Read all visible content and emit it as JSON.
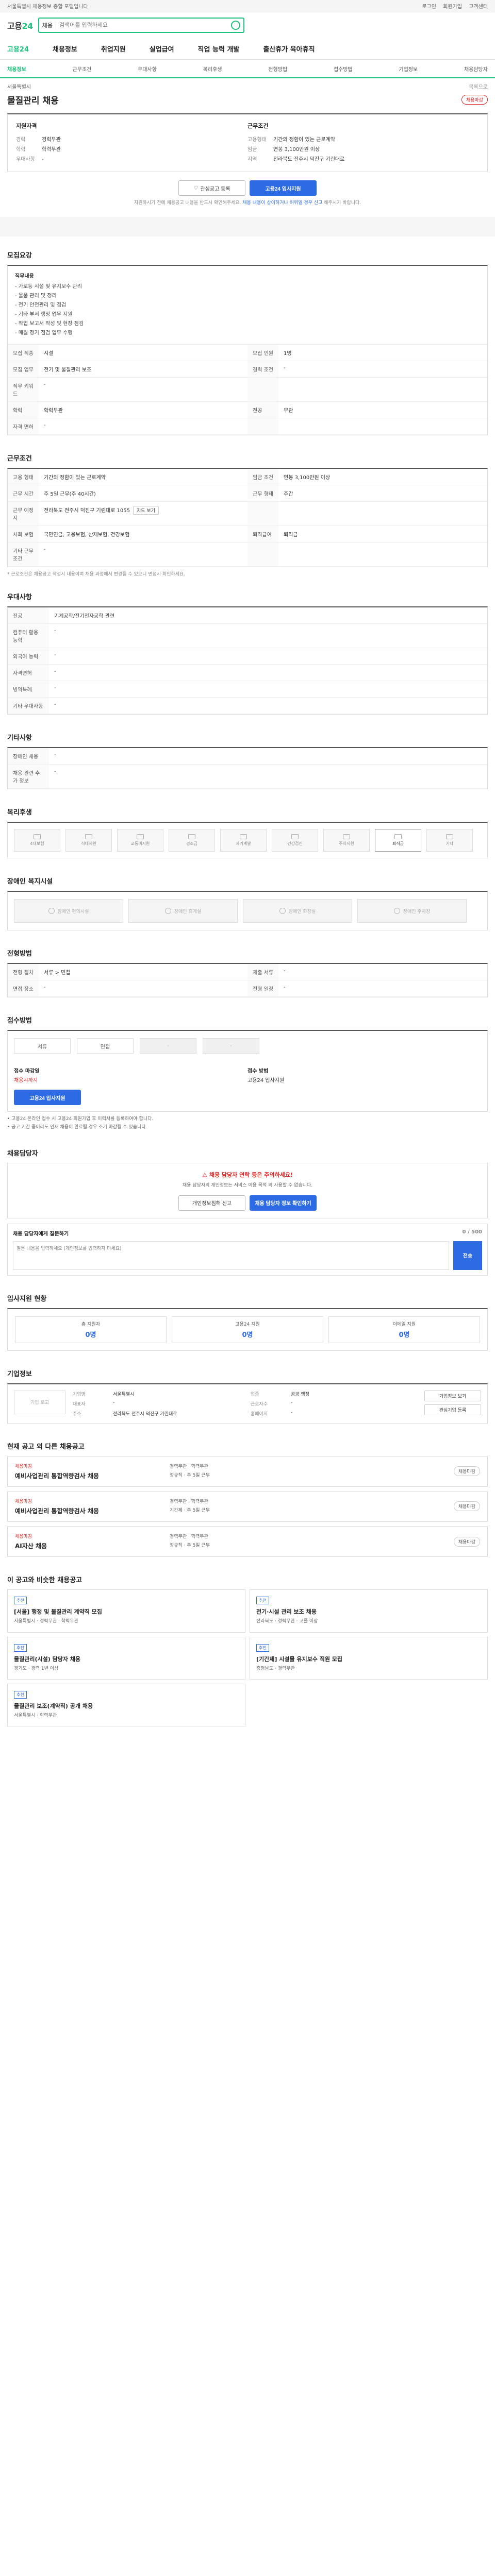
{
  "topbar": {
    "notice": "서울특별시 채용정보 종합 포털입니다",
    "links": [
      "로그인",
      "회원가입",
      "고객센터"
    ]
  },
  "header": {
    "logo_a": "고용",
    "logo_b": "24",
    "search_select": "채용",
    "search_placeholder": "검색어를 입력하세요"
  },
  "gnb": [
    "고용24",
    "채용정보",
    "취업지원",
    "실업급여",
    "직업 능력 개발",
    "출산휴가 육아휴직"
  ],
  "tabs": [
    "채용정보",
    "근무조건",
    "우대사항",
    "복리후생",
    "전형방법",
    "접수방법",
    "기업정보",
    "채용담당자"
  ],
  "title": {
    "company": "서울특별시",
    "back": "목록으로",
    "job": "물질관리 채용",
    "status": "채용마감"
  },
  "summary": {
    "left_title": "지원자격",
    "left": [
      [
        "경력",
        "경력무관"
      ],
      [
        "학력",
        "학력무관"
      ],
      [
        "우대사항",
        "-"
      ]
    ],
    "right_title": "근무조건",
    "right": [
      [
        "고용형태",
        "기간의 정함이 있는 근로계약"
      ],
      [
        "임금",
        "연봉 3,100만원 이상"
      ],
      [
        "지역",
        "전라북도 전주시 덕진구 기린대로"
      ]
    ]
  },
  "apply": {
    "scrap": "관심공고 등록",
    "apply": "고용24 입사지원",
    "note_pre": "지원하시기 전에 채용공고 내용을 반드시 확인해주세요. ",
    "note_link": "채용 내용이 상이하거나 허위일 경우 신고",
    "note_post": " 해주시기 바랍니다."
  },
  "recruit": {
    "title": "모집요강",
    "duty_title": "직무내용",
    "duty_lines": [
      "- 가로등 시설 및 유지보수 관리",
      "- 물품 관리 및 정리",
      "- 전기 안전관리 및 점검",
      "- 기타 부서 행정 업무 지원",
      "- 작업 보고서 작성 및 현장 점검",
      "- 매월 정기 점검 업무 수행"
    ],
    "rows": [
      [
        "모집 직종",
        "시설",
        "모집 인원",
        "1명"
      ],
      [
        "모집 업무",
        "전기 및 물질관리 보조",
        "경력 조건",
        "-"
      ],
      [
        "직무 키워드",
        "-",
        "",
        ""
      ],
      [
        "학력",
        "학력무관",
        "전공",
        "무관"
      ],
      [
        "자격 면허",
        "-",
        "",
        ""
      ]
    ]
  },
  "condition": {
    "title": "근무조건",
    "rows": [
      [
        "고용 형태",
        "기간의 정함이 있는 근로계약",
        "임금 조건",
        "연봉 3,100만원 이상"
      ],
      [
        "근무 시간",
        "주 5일 근무(주 40시간)",
        "근무 형태",
        "주간"
      ],
      [
        "근무 예정지",
        "전라북도 전주시 덕진구 기린대로 1055",
        "",
        ""
      ],
      [
        "사회 보험",
        "국민연금, 고용보험, 산재보험, 건강보험",
        "퇴직급여",
        "퇴직금"
      ],
      [
        "기타 근무조건",
        "-",
        "",
        ""
      ]
    ],
    "map_label": "지도 보기",
    "footnote": "* 근로조건은 채용공고 작성시 내용이며 채용 과정에서 변경될 수 있으니 면접시 확인하세요."
  },
  "prefer": {
    "title": "우대사항",
    "rows": [
      [
        "전공",
        "기계공학/전기전자공학 관련"
      ],
      [
        "컴퓨터 활용 능력",
        "-"
      ],
      [
        "외국어 능력",
        "-"
      ],
      [
        "자격면허",
        "-"
      ],
      [
        "병역특례",
        "-"
      ],
      [
        "기타 우대사항",
        "-"
      ]
    ]
  },
  "etc": {
    "title": "기타사항",
    "rows": [
      [
        "장애인 채용",
        "-"
      ],
      [
        "채용 관련 추가 정보",
        "-"
      ]
    ]
  },
  "welfare": {
    "title": "복리후생",
    "items": [
      "4대보험",
      "식대지원",
      "교통비지원",
      "경조금",
      "자기계발",
      "건강검진",
      "주차지원",
      "퇴직금",
      "기타"
    ],
    "selected_index": 7
  },
  "welfare2": {
    "title": "장애인 복지시설",
    "items": [
      "장애인 편의시설",
      "장애인 휴게실",
      "장애인 화장실",
      "장애인 주차장"
    ]
  },
  "process": {
    "title": "전형방법",
    "rows": [
      [
        "전형 절차",
        "서류 > 면접",
        "제출 서류",
        "-"
      ],
      [
        "면접 장소",
        "-",
        "전형 일정",
        "-"
      ]
    ]
  },
  "method": {
    "title": "접수방법",
    "steps": [
      "서류",
      "면접",
      "-",
      "-"
    ],
    "period_label": "접수 마감일",
    "period": "채용시까지",
    "method_label": "접수 방법",
    "method": "고용24 입사지원",
    "bullets": [
      "• 고용24 온라인 접수 시 고용24 회원가입 후 이력서를 등록하여야 합니다.",
      "• 공고 기간 중이라도 인재 채용이 완료될 경우 조기 마감될 수 있습니다."
    ]
  },
  "contact": {
    "title": "채용담당자",
    "warn": "채용 담당자 연락 등은 주의하세요!",
    "sub": "채용 담당자의 개인정보는 서비스 이용 목적 외 사용할 수 없습니다.",
    "btn1": "개인정보침해 신고",
    "btn2": "채용 담당자 정보 확인하기"
  },
  "qna": {
    "title": "채용 담당자에게 질문하기",
    "count": "0 / 500",
    "placeholder": "질문 내용을 입력하세요 (개인정보를 입력하지 마세요)",
    "send": "전송"
  },
  "stats": {
    "title": "입사지원 현황",
    "items": [
      [
        "총 지원자",
        "0명"
      ],
      [
        "고용24 지원",
        "0명"
      ],
      [
        "이메일 지원",
        "0명"
      ]
    ]
  },
  "company": {
    "title": "기업정보",
    "logo": "기업 로고",
    "rows": [
      [
        "기업명",
        "서울특별시",
        "업종",
        "공공 행정"
      ],
      [
        "대표자",
        "-",
        "근로자수",
        "-"
      ],
      [
        "주소",
        "전라북도 전주시 덕진구 기린대로",
        "홈페이지",
        "-"
      ]
    ],
    "side": [
      "기업정보 보기",
      "관심기업 등록"
    ]
  },
  "related": {
    "title": "현재 공고 외 다른 채용공고",
    "cards": [
      {
        "tag": "채용마감",
        "title": "예비사업관리 통합역량검사 채용",
        "m1": "경력무관 · 학력무관",
        "m2": "정규직 · 주 5일 근무",
        "r": "채용마감"
      },
      {
        "tag": "채용마감",
        "title": "예비사업관리 통합역량검사 채용",
        "m1": "경력무관 · 학력무관",
        "m2": "기간제 · 주 5일 근무",
        "r": "채용마감"
      },
      {
        "tag": "채용마감",
        "title": "AI자산 채용",
        "m1": "경력무관 · 학력무관",
        "m2": "정규직 · 주 5일 근무",
        "r": "채용마감"
      }
    ]
  },
  "recommend": {
    "title": "이 공고와 비슷한 채용공고",
    "items": [
      {
        "badge": "추천",
        "title": "[서울] 행정 및 물질관리 계약직 모집",
        "sm": "서울특별시 · 경력무관 · 학력무관"
      },
      {
        "badge": "추천",
        "title": "전기·시설 관리 보조 채용",
        "sm": "전라북도 · 경력무관 · 고졸 이상"
      },
      {
        "badge": "추천",
        "title": "물질관리(시설) 담당자 채용",
        "sm": "경기도 · 경력 1년 이상"
      },
      {
        "badge": "추천",
        "title": "[기간제] 시설물 유지보수 직원 모집",
        "sm": "충청남도 · 경력무관"
      },
      {
        "badge": "추천",
        "title": "물질관리 보조(계약직) 공개 채용",
        "sm": "서울특별시 · 학력무관"
      }
    ]
  }
}
